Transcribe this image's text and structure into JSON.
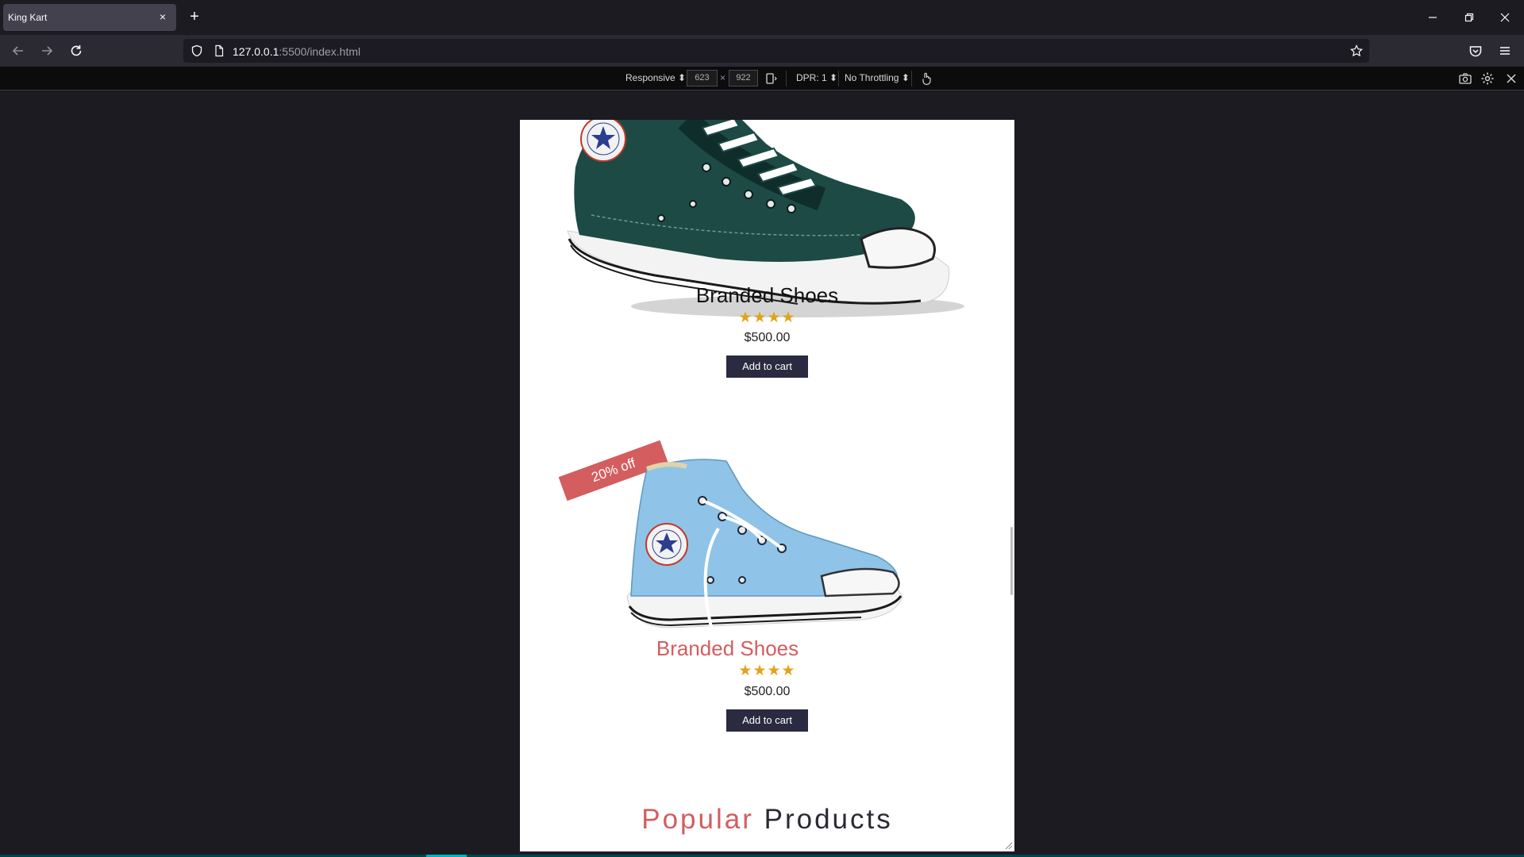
{
  "browser": {
    "tab_title": "King Kart",
    "tab_close": "×",
    "new_tab": "+",
    "url_host": "127.0.0.1",
    "url_rest": ":5500/index.html"
  },
  "rdm": {
    "device": "Responsive",
    "width": "623",
    "times": "×",
    "height": "922",
    "dpr": "DPR: 1",
    "throttling": "No Throttling"
  },
  "products": [
    {
      "name": "Branded Shoes",
      "rating_stars": "★★★★",
      "price": "$500.00",
      "button": "Add to cart",
      "image": "green-high-top-sneaker"
    },
    {
      "badge": "20% off",
      "name": "Branded Shoes",
      "rating_stars": "★★★★",
      "price": "$500.00",
      "button": "Add to cart",
      "image": "light-blue-high-top-sneaker"
    }
  ],
  "section": {
    "title_accent": "Popular",
    "title_rest": "Products"
  },
  "colors": {
    "accent": "#d35d5f",
    "button_bg": "#2a2a40",
    "star": "#e3a21a",
    "shoe_green": "#1d4a45",
    "shoe_blue": "#8fc3e8"
  }
}
